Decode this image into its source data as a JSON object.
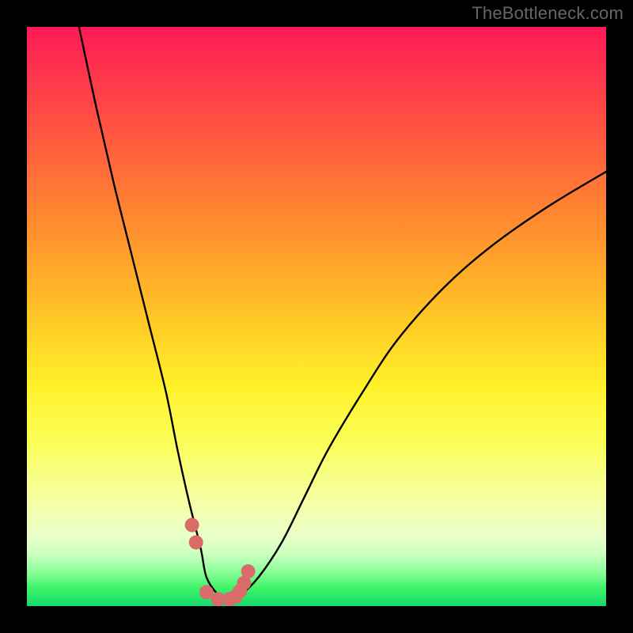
{
  "watermark": "TheBottleneck.com",
  "colors": {
    "frame": "#000000",
    "curve": "#000000",
    "marker": "#d96b6b"
  },
  "chart_data": {
    "type": "line",
    "title": "",
    "xlabel": "",
    "ylabel": "",
    "xlim": [
      0,
      100
    ],
    "ylim": [
      0,
      100
    ],
    "series": [
      {
        "name": "bottleneck-curve",
        "x": [
          9,
          12,
          15,
          18,
          21,
          24,
          26,
          28,
          30,
          31,
          33,
          35,
          37,
          40,
          44,
          48,
          52,
          58,
          64,
          72,
          80,
          90,
          100
        ],
        "values": [
          100,
          86,
          73,
          61,
          49,
          37,
          27,
          18,
          10,
          5,
          2,
          1,
          2,
          5,
          11,
          19,
          27,
          37,
          46,
          55,
          62,
          69,
          75
        ]
      }
    ],
    "markers": {
      "name": "highlighted-range",
      "x": [
        28.5,
        29.2,
        31.0,
        33.0,
        35.0,
        36.0,
        36.8,
        37.5,
        38.2
      ],
      "values": [
        14.0,
        11.0,
        2.4,
        1.2,
        1.2,
        1.6,
        2.6,
        4.0,
        6.0
      ]
    }
  }
}
